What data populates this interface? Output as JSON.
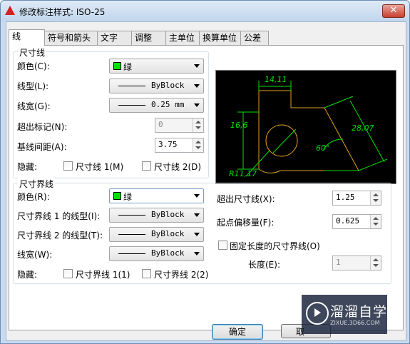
{
  "window": {
    "title": "修改标注样式: ISO-25",
    "close_glyph": "✕"
  },
  "tabs": [
    {
      "label": "线",
      "active": true
    },
    {
      "label": "符号和箭头",
      "active": false
    },
    {
      "label": "文字",
      "active": false
    },
    {
      "label": "调整",
      "active": false
    },
    {
      "label": "主单位",
      "active": false
    },
    {
      "label": "换算单位",
      "active": false
    },
    {
      "label": "公差",
      "active": false
    }
  ],
  "dim_line": {
    "title": "尺寸线",
    "color_label": "颜色(C):",
    "color_value": "绿",
    "color_hex": "#00e000",
    "linetype_label": "线型(L):",
    "linetype_value": "ByBlock",
    "lineweight_label": "线宽(G):",
    "lineweight_value": "0.25 mm",
    "extend_label": "超出标记(N):",
    "extend_value": "0",
    "baseline_label": "基线间距(A):",
    "baseline_value": "3.75",
    "suppress_label": "隐藏:",
    "suppress_1": "尺寸线 1(M)",
    "suppress_2": "尺寸线 2(D)"
  },
  "ext_line": {
    "title": "尺寸界线",
    "color_label": "颜色(R):",
    "color_value": "绿",
    "linetype1_label": "尺寸界线 1 的线型(I):",
    "linetype1_value": "ByBlock",
    "linetype2_label": "尺寸界线 2 的线型(T):",
    "linetype2_value": "ByBlock",
    "lineweight_label": "线宽(W):",
    "lineweight_value": "ByBlock",
    "suppress_label": "隐藏:",
    "suppress_1": "尺寸界线 1(1)",
    "suppress_2": "尺寸界线 2(2)",
    "beyond_label": "超出尺寸线(X):",
    "beyond_value": "1.25",
    "offset_label": "起点偏移量(F):",
    "offset_value": "0.625",
    "fixed_label": "固定长度的尺寸界线(O)",
    "length_label": "长度(E):",
    "length_value": "1"
  },
  "preview": {
    "dim_top": "14,11",
    "dim_left": "16,6",
    "dim_right": "28,07",
    "dim_angle": "60°",
    "dim_radius": "R11,17"
  },
  "buttons": {
    "ok": "确定",
    "cancel": "取"
  },
  "watermark": {
    "text": "溜溜自学",
    "sub": "ZIXUE.3D66.COM"
  }
}
